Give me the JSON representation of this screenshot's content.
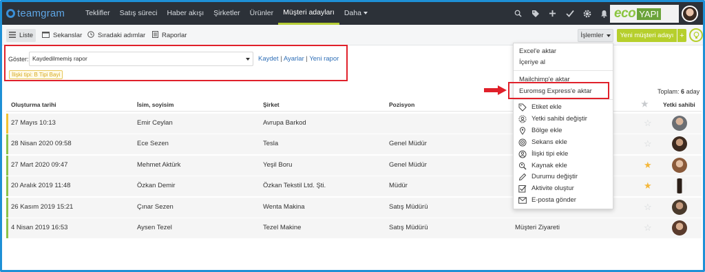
{
  "nav": {
    "logo": "teamgram",
    "items": [
      "Teklifler",
      "Satış süreci",
      "Haber akışı",
      "Şirketler",
      "Ürünler",
      "Müşteri adayları",
      "Daha"
    ],
    "active": "Müşteri adayları",
    "icons": [
      "search-icon",
      "tag-icon",
      "plus-icon",
      "check-icon",
      "gear-icon",
      "bell-icon"
    ],
    "brand_eco": "eco",
    "brand_yapi": "YAPI"
  },
  "toolbar": {
    "tabs": [
      "Liste",
      "Sekanslar",
      "Sıradaki adımlar",
      "Raporlar"
    ],
    "islemler": "İşlemler",
    "new_lead": "Yeni müşteri adayı",
    "plus": "+"
  },
  "filter": {
    "label": "Göster:",
    "selected": "Kaydedilmemiş rapor",
    "save": "Kaydet",
    "settings": "Ayarlar",
    "new_report": "Yeni rapor",
    "sep": "|",
    "tag": "İlişki tipi: B Tipi Bayi"
  },
  "summary": {
    "label": "Toplam:",
    "count": "6",
    "unit": "aday"
  },
  "table": {
    "headers": [
      "Oluşturma tarihi",
      "İsim, soyisim",
      "Şirket",
      "Pozisyon",
      "Yetki sahibi"
    ],
    "rows": [
      {
        "date": "27 Mayıs 10:13",
        "name": "Emir Ceylan",
        "company": "Avrupa Barkod",
        "position": "",
        "status": "",
        "starred": false
      },
      {
        "date": "28 Nisan 2020 09:58",
        "name": "Ece Sezen",
        "company": "Tesla",
        "position": "Genel Müdür",
        "status": "",
        "starred": false
      },
      {
        "date": "27 Mart 2020 09:47",
        "name": "Mehmet Aktürk",
        "company": "Yeşil Boru",
        "position": "Genel Müdür",
        "status": "",
        "starred": true
      },
      {
        "date": "20 Aralık 2019 11:48",
        "name": "Özkan Demir",
        "company": "Özkan Tekstil Ltd. Şti.",
        "position": "Müdür",
        "status": "",
        "starred": true
      },
      {
        "date": "26 Kasım 2019 15:21",
        "name": "Çınar Sezen",
        "company": "Wenta Makina",
        "position": "Satış Müdürü",
        "status": "",
        "starred": false
      },
      {
        "date": "4 Nisan 2019 16:53",
        "name": "Aysen Tezel",
        "company": "Tezel Makine",
        "position": "Satış Müdürü",
        "status": "Müşteri Ziyareti",
        "starred": false
      }
    ]
  },
  "menu": {
    "top_items": [
      "Excel'e aktar",
      "İçeriye al",
      "Mailchimp'e aktar",
      "Euromsg Express'e aktar"
    ],
    "icon_items": [
      {
        "label": "Etiket ekle",
        "icon": "tag-icon"
      },
      {
        "label": "Yetki sahibi değiştir",
        "icon": "user-gear-icon"
      },
      {
        "label": "Bölge ekle",
        "icon": "map-pin-icon"
      },
      {
        "label": "Sekans ekle",
        "icon": "target-icon"
      },
      {
        "label": "İlişki tipi ekle",
        "icon": "relation-icon"
      },
      {
        "label": "Kaynak ekle",
        "icon": "source-icon"
      },
      {
        "label": "Durumu değiştir",
        "icon": "pencil-icon"
      },
      {
        "label": "Aktivite oluştur",
        "icon": "checkbox-icon"
      },
      {
        "label": "E-posta gönder",
        "icon": "envelope-icon"
      }
    ]
  },
  "colors": {
    "nav_bg": "#2c3138",
    "accent": "#b6cf2c",
    "highlight": "#e0202a",
    "star": "#f4b73a"
  }
}
